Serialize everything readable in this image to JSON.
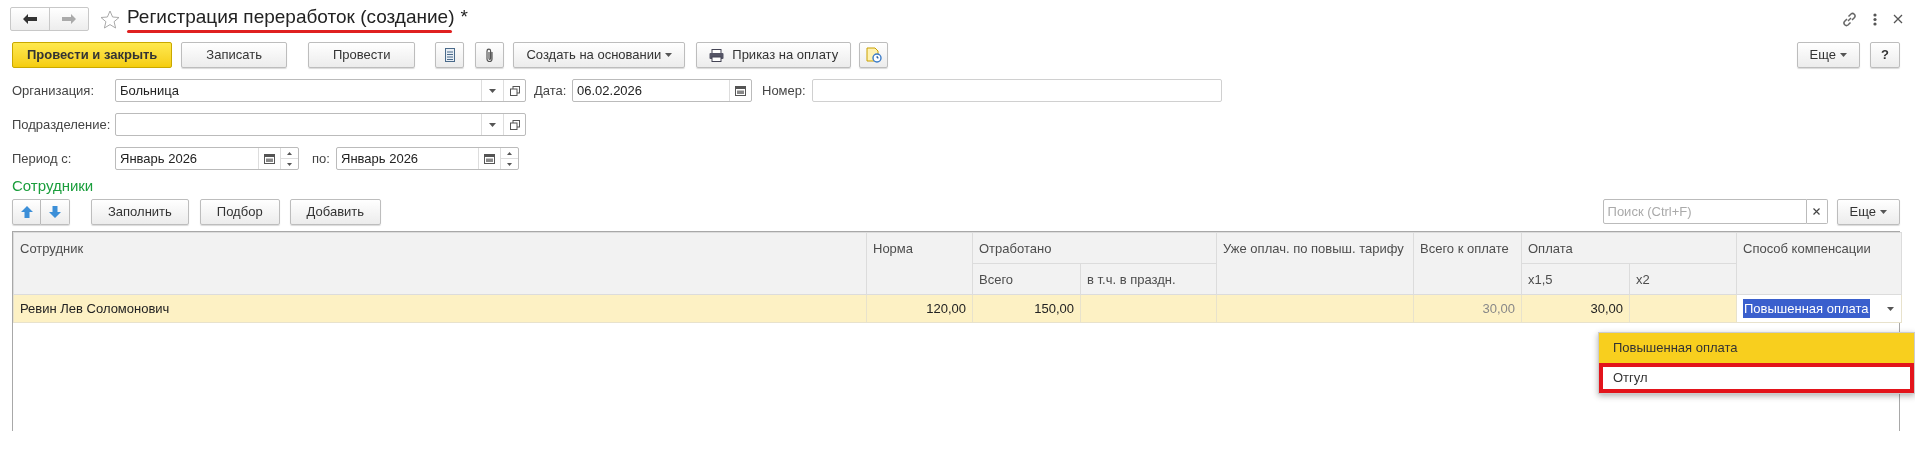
{
  "window": {
    "title": "Регистрация переработок (создание)",
    "modified_mark": "*",
    "title_underlined": true
  },
  "toolbar": {
    "buttons": [
      {
        "kind": "primary",
        "label": "Провести и закрыть"
      },
      {
        "kind": "default",
        "label": "Записать"
      },
      {
        "kind": "default",
        "label": "Провести"
      },
      {
        "kind": "icon"
      },
      {
        "kind": "icon"
      },
      {
        "kind": "menu",
        "label": "Создать на основании"
      },
      {
        "kind": "print",
        "label": "Приказ на оплату"
      },
      {
        "kind": "icon"
      }
    ],
    "more": "Еще",
    "help": "?"
  },
  "organization": {
    "label": "Организация:",
    "value": "Больница"
  },
  "date": {
    "label": "Дата:",
    "value": "06.02.2026"
  },
  "number": {
    "label": "Номер:"
  },
  "subdivision": {
    "label": "Подразделение:"
  },
  "period": {
    "label_from": "Период с:",
    "from": "Январь 2026",
    "label_to": "по:",
    "to": "Январь 2026"
  },
  "employees": {
    "title": "Сотрудники",
    "buttons": [
      "Заполнить",
      "Подбор",
      "Добавить"
    ],
    "search": {
      "placeholder": "Поиск (Ctrl+F)"
    },
    "more": "Еще",
    "table": {
      "columns": [
        {
          "label": "Сотрудник"
        },
        {
          "label": "Норма"
        },
        {
          "label": "Отработано",
          "colspan": 2,
          "children": [
            {
              "label": "Всего"
            },
            {
              "label": "в т.ч. в праздн."
            }
          ]
        },
        {
          "label": "Уже оплач. по повыш. тарифу"
        },
        {
          "label": "Всего к оплате",
          "readonly": true
        },
        {
          "label": "Оплата",
          "colspan": 2,
          "children": [
            {
              "label": "x1,5"
            },
            {
              "label": "x2"
            }
          ]
        },
        {
          "label": "Способ компенсации"
        }
      ],
      "rows": [
        {
          "selected": true,
          "cells": [
            "Ревин Лев Соломонович",
            "120,00",
            "150,00",
            "",
            "",
            "30,00",
            "30,00",
            "",
            "Повышенная оплата"
          ]
        }
      ],
      "dropdown": {
        "options": [
          {
            "label": "Повышенная оплата",
            "selected": true,
            "highlighted": false
          },
          {
            "label": "Отгул",
            "selected": false,
            "highlighted": true
          }
        ]
      }
    }
  }
}
